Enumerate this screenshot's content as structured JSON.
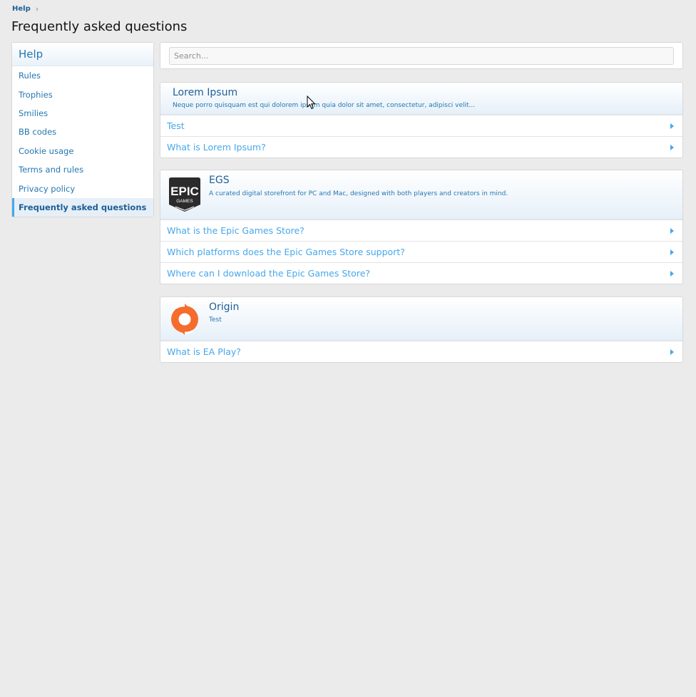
{
  "breadcrumb": {
    "label": "Help",
    "separator": "›"
  },
  "page": {
    "title": "Frequently asked questions"
  },
  "sidebar": {
    "title": "Help",
    "items": [
      {
        "label": "Rules"
      },
      {
        "label": "Trophies"
      },
      {
        "label": "Smilies"
      },
      {
        "label": "BB codes"
      },
      {
        "label": "Cookie usage"
      },
      {
        "label": "Terms and rules"
      },
      {
        "label": "Privacy policy"
      },
      {
        "label": "Frequently asked questions",
        "active": true
      }
    ]
  },
  "search": {
    "placeholder": "Search..."
  },
  "categories": [
    {
      "title": "Lorem Ipsum",
      "description": "Neque porro quisquam est qui dolorem ipsum quia dolor sit amet, consectetur, adipisci velit...",
      "questions": [
        "Test",
        "What is Lorem Ipsum?"
      ]
    },
    {
      "title": "EGS",
      "icon": "epic-games-logo",
      "logo_text": {
        "top": "EPIC",
        "bottom": "GAMES"
      },
      "description": "A curated digital storefront for PC and Mac, designed with both players and creators in mind.",
      "questions": [
        "What is the Epic Games Store?",
        "Which platforms does the Epic Games Store support?",
        "Where can I download the Epic Games Store?"
      ]
    },
    {
      "title": "Origin",
      "icon": "origin-logo",
      "description": "Test",
      "questions": [
        "What is EA Play?"
      ]
    }
  ],
  "colors": {
    "accent": "#47a7eb",
    "link": "#2577b1",
    "dark_link": "#1d5f96",
    "background": "#ebebeb",
    "origin": "#f56c2d"
  }
}
